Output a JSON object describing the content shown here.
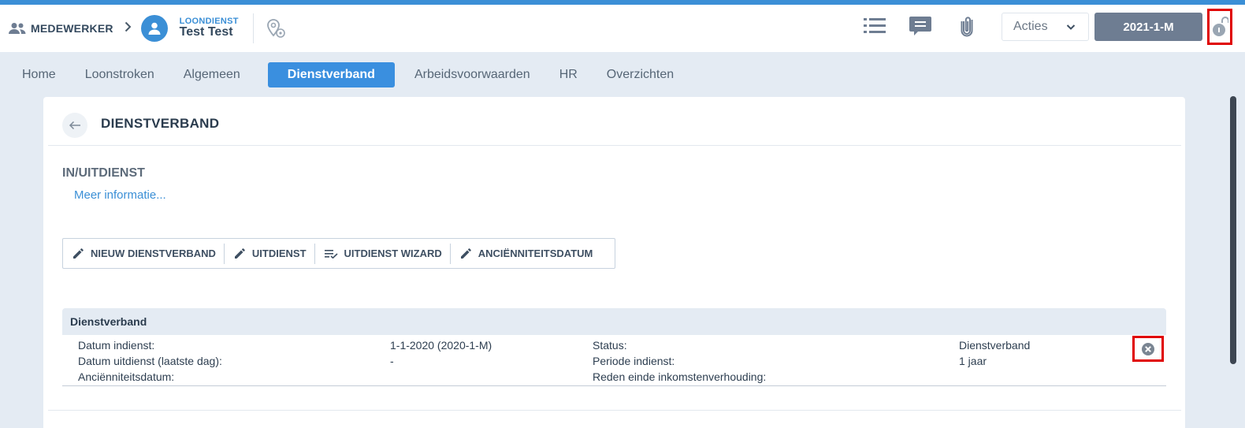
{
  "header": {
    "breadcrumb_employee": "MEDEWERKER",
    "person_label": "LOONDIENST",
    "person_name": "Test Test",
    "acties_label": "Acties",
    "period": "2021-1-M",
    "icons": [
      "people-icon",
      "chevron-right-icon",
      "user-icon",
      "pin-settings-icon",
      "list-icon",
      "comment-icon",
      "attachment-icon",
      "chevron-down-icon",
      "unlock-icon"
    ]
  },
  "tabs": [
    "Home",
    "Loonstroken",
    "Algemeen",
    "Dienstverband",
    "Arbeidsvoorwaarden",
    "HR",
    "Overzichten"
  ],
  "active_tab": "Dienstverband",
  "page": {
    "title": "DIENSTVERBAND",
    "section": "IN/UITDIENST",
    "more_info": "Meer informatie..."
  },
  "actions": {
    "new": "NIEUW DIENSTVERBAND",
    "uitdienst": "UITDIENST",
    "wizard": "UITDIENST WIZARD",
    "anciennity": "ANCIËNNITEITSDATUM"
  },
  "table": {
    "title": "Dienstverband",
    "rows": [
      {
        "l1": "Datum indienst:",
        "v1": "1-1-2020 (2020-1-M)",
        "l2": "Status:",
        "v2": "Dienstverband"
      },
      {
        "l1": "Datum uitdienst (laatste dag):",
        "v1": "-",
        "l2": "Periode indienst:",
        "v2": "1 jaar"
      },
      {
        "l1": "Anciënniteitsdatum:",
        "v1": "",
        "l2": "Reden einde inkomstenverhouding:",
        "v2": ""
      }
    ]
  },
  "colors": {
    "accent": "#3b8fd6",
    "period_bg": "#6e7d92",
    "highlight_red": "#e00000"
  }
}
